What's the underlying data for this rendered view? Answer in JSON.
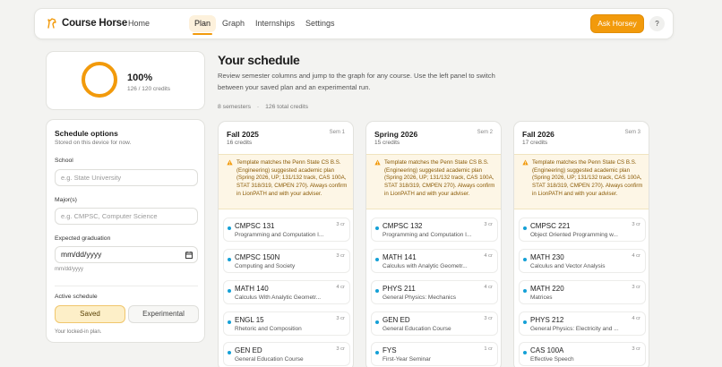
{
  "app": {
    "brand": "Course Horse"
  },
  "nav": {
    "links": [
      "Home",
      "Plan",
      "Graph",
      "Internships",
      "Settings"
    ],
    "active": "Plan",
    "ask_button": "Ask Horsey",
    "help_button": "?"
  },
  "colors": {
    "accent": "#f29a0b",
    "info_dot": "#14a0d6",
    "warning_bg": "#fdf6e6"
  },
  "progress": {
    "percent_label": "100%",
    "percent_value": 100,
    "credits_label": "126 / 120 credits"
  },
  "schedule": {
    "title": "Your schedule",
    "description": "Review semester columns and jump to the graph for any course. Use the left panel to switch between your saved plan and an experimental run.",
    "semesters_count": "8 semesters",
    "separator": "·",
    "total_credits": "126 total credits"
  },
  "options": {
    "title": "Schedule options",
    "subtitle": "Stored on this device for now.",
    "school_label": "School",
    "school_placeholder": "e.g. State University",
    "major_label": "Major(s)",
    "major_placeholder": "e.g. CMPSC, Computer Science",
    "grad_label": "Expected graduation",
    "grad_value": "mm/dd/yyyy",
    "grad_hint": "mm/dd/yyyy",
    "active_label": "Active schedule",
    "saved_button": "Saved",
    "experimental_button": "Experimental",
    "locked_text": "Your locked-in plan."
  },
  "semesters": [
    {
      "title": "Fall 2025",
      "tag": "Sem 1",
      "credits": "16 credits",
      "warning": "Template matches the Penn State CS B.S. (Engineering) suggested academic plan (Spring 2026, UP; 131/132 track, CAS 100A, STAT 318/319, CMPEN 270). Always confirm in LionPATH and with your adviser.",
      "courses": [
        {
          "code": "CMPSC 131",
          "name": "Programming and Computation I...",
          "credits": "3 cr"
        },
        {
          "code": "CMPSC 150N",
          "name": "Computing and Society",
          "credits": "3 cr"
        },
        {
          "code": "MATH 140",
          "name": "Calculus With Analytic Geometr...",
          "credits": "4 cr"
        },
        {
          "code": "ENGL 15",
          "name": "Rhetoric and Composition",
          "credits": "3 cr"
        },
        {
          "code": "GEN ED",
          "name": "General Education Course",
          "credits": "3 cr"
        }
      ]
    },
    {
      "title": "Spring 2026",
      "tag": "Sem 2",
      "credits": "15 credits",
      "warning": "Template matches the Penn State CS B.S. (Engineering) suggested academic plan (Spring 2026, UP; 131/132 track, CAS 100A, STAT 318/319, CMPEN 270). Always confirm in LionPATH and with your adviser.",
      "courses": [
        {
          "code": "CMPSC 132",
          "name": "Programming and Computation I...",
          "credits": "3 cr"
        },
        {
          "code": "MATH 141",
          "name": "Calculus with Analytic Geometr...",
          "credits": "4 cr"
        },
        {
          "code": "PHYS 211",
          "name": "General Physics: Mechanics",
          "credits": "4 cr"
        },
        {
          "code": "GEN ED",
          "name": "General Education Course",
          "credits": "3 cr"
        },
        {
          "code": "FYS",
          "name": "First-Year Seminar",
          "credits": "1 cr"
        }
      ]
    },
    {
      "title": "Fall 2026",
      "tag": "Sem 3",
      "credits": "17 credits",
      "warning": "Template matches the Penn State CS B.S. (Engineering) suggested academic plan (Spring 2026, UP; 131/132 track, CAS 100A, STAT 318/319, CMPEN 270). Always confirm in LionPATH and with your adviser.",
      "courses": [
        {
          "code": "CMPSC 221",
          "name": "Object Oriented Programming w...",
          "credits": "3 cr"
        },
        {
          "code": "MATH 230",
          "name": "Calculus and Vector Analysis",
          "credits": "4 cr"
        },
        {
          "code": "MATH 220",
          "name": "Matrices",
          "credits": "3 cr"
        },
        {
          "code": "PHYS 212",
          "name": "General Physics: Electricity and ...",
          "credits": "4 cr"
        },
        {
          "code": "CAS 100A",
          "name": "Effective Speech",
          "credits": "3 cr"
        }
      ]
    }
  ]
}
